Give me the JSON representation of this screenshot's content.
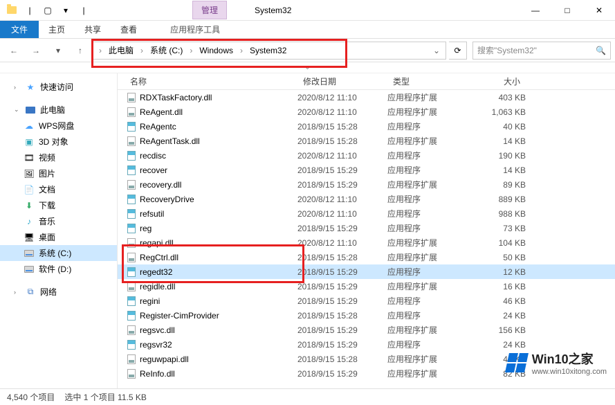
{
  "title": "System32",
  "ribbon_context": "管理",
  "tool_tab": "应用程序工具",
  "menu": {
    "file": "文件",
    "home": "主页",
    "share": "共享",
    "view": "查看"
  },
  "breadcrumb": {
    "root": "此电脑",
    "c": "系统 (C:)",
    "w": "Windows",
    "s": "System32"
  },
  "search_placeholder": "搜索\"System32\"",
  "columns": {
    "name": "名称",
    "date": "修改日期",
    "type": "类型",
    "size": "大小"
  },
  "sidebar": {
    "quick": "快速访问",
    "thispc": "此电脑",
    "wps": "WPS网盘",
    "obj3d": "3D 对象",
    "video": "视频",
    "pic": "图片",
    "doc": "文档",
    "down": "下载",
    "music": "音乐",
    "desktop": "桌面",
    "drivec": "系统 (C:)",
    "drived": "软件 (D:)",
    "network": "网络"
  },
  "files": [
    {
      "icon": "dll",
      "name": "RDXTaskFactory.dll",
      "date": "2020/8/12 11:10",
      "type": "应用程序扩展",
      "size": "403 KB"
    },
    {
      "icon": "dll",
      "name": "ReAgent.dll",
      "date": "2020/8/12 11:10",
      "type": "应用程序扩展",
      "size": "1,063 KB"
    },
    {
      "icon": "exe",
      "name": "ReAgentc",
      "date": "2018/9/15 15:28",
      "type": "应用程序",
      "size": "40 KB"
    },
    {
      "icon": "dll",
      "name": "ReAgentTask.dll",
      "date": "2018/9/15 15:28",
      "type": "应用程序扩展",
      "size": "14 KB"
    },
    {
      "icon": "exe",
      "name": "recdisc",
      "date": "2020/8/12 11:10",
      "type": "应用程序",
      "size": "190 KB"
    },
    {
      "icon": "exe",
      "name": "recover",
      "date": "2018/9/15 15:29",
      "type": "应用程序",
      "size": "14 KB"
    },
    {
      "icon": "dll",
      "name": "recovery.dll",
      "date": "2018/9/15 15:29",
      "type": "应用程序扩展",
      "size": "89 KB"
    },
    {
      "icon": "exe",
      "name": "RecoveryDrive",
      "date": "2020/8/12 11:10",
      "type": "应用程序",
      "size": "889 KB"
    },
    {
      "icon": "exe",
      "name": "refsutil",
      "date": "2020/8/12 11:10",
      "type": "应用程序",
      "size": "988 KB"
    },
    {
      "icon": "exe",
      "name": "reg",
      "date": "2018/9/15 15:29",
      "type": "应用程序",
      "size": "73 KB"
    },
    {
      "icon": "dll",
      "name": "regapi.dll",
      "date": "2020/8/12 11:10",
      "type": "应用程序扩展",
      "size": "104 KB"
    },
    {
      "icon": "dll",
      "name": "RegCtrl.dll",
      "date": "2018/9/15 15:28",
      "type": "应用程序扩展",
      "size": "50 KB"
    },
    {
      "icon": "exe",
      "name": "regedt32",
      "date": "2018/9/15 15:29",
      "type": "应用程序",
      "size": "12 KB",
      "selected": true
    },
    {
      "icon": "dll",
      "name": "regidle.dll",
      "date": "2018/9/15 15:29",
      "type": "应用程序扩展",
      "size": "16 KB"
    },
    {
      "icon": "exe",
      "name": "regini",
      "date": "2018/9/15 15:29",
      "type": "应用程序",
      "size": "46 KB"
    },
    {
      "icon": "exe",
      "name": "Register-CimProvider",
      "date": "2018/9/15 15:28",
      "type": "应用程序",
      "size": "24 KB"
    },
    {
      "icon": "dll",
      "name": "regsvc.dll",
      "date": "2018/9/15 15:29",
      "type": "应用程序扩展",
      "size": "156 KB"
    },
    {
      "icon": "exe",
      "name": "regsvr32",
      "date": "2018/9/15 15:29",
      "type": "应用程序",
      "size": "24 KB"
    },
    {
      "icon": "dll",
      "name": "reguwpapi.dll",
      "date": "2018/9/15 15:28",
      "type": "应用程序扩展",
      "size": "40 KB"
    },
    {
      "icon": "dll",
      "name": "ReInfo.dll",
      "date": "2018/9/15 15:29",
      "type": "应用程序扩展",
      "size": "82 KB"
    }
  ],
  "status": {
    "count": "4,540 个项目",
    "selection": "选中 1 个项目 11.5 KB"
  },
  "watermark": {
    "brand": "Win10之家",
    "url": "www.win10xitong.com"
  }
}
